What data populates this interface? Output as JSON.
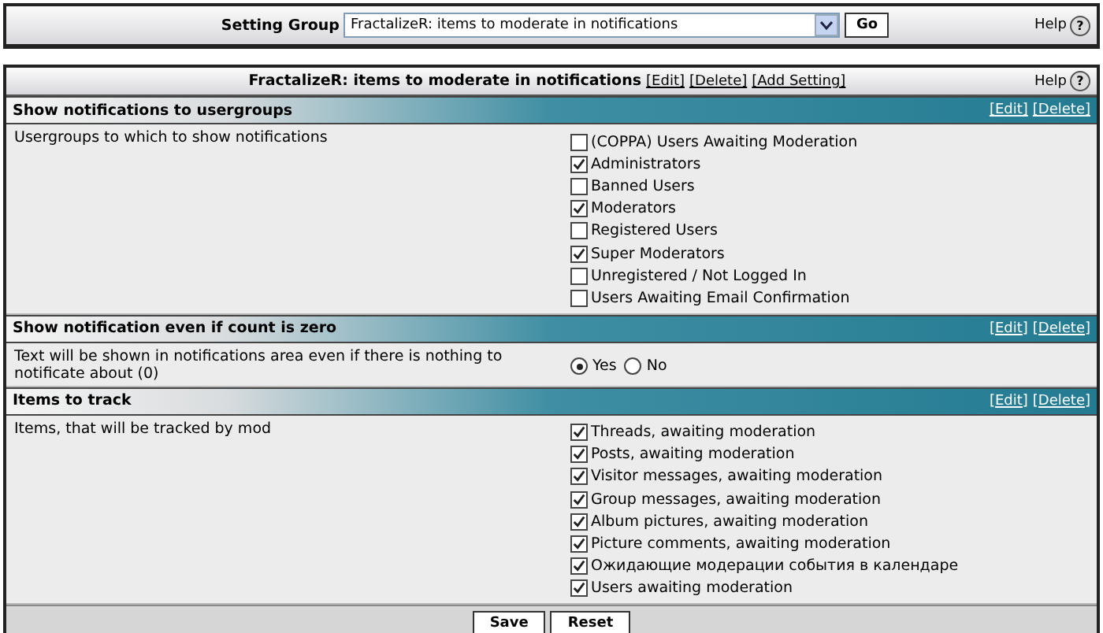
{
  "top_bar": {
    "label": "Setting Group",
    "select_value": "FractalizeR: items to moderate in notifications",
    "go_button": "Go",
    "help": "Help",
    "help_icon": "?"
  },
  "panel": {
    "title": "FractalizeR: items to moderate in notifications",
    "links": [
      "[Edit]",
      "[Delete]",
      "[Add Setting]"
    ],
    "help": "Help",
    "help_icon": "?",
    "sections": [
      {
        "title": "Show notifications to usergroups",
        "links": [
          "[Edit]",
          "[Delete]"
        ],
        "description": "Usergroups to which to show notifications",
        "kind": "checkboxes",
        "options": [
          {
            "label": "(COPPA) Users Awaiting Moderation",
            "checked": false
          },
          {
            "label": "Administrators",
            "checked": true
          },
          {
            "label": "Banned Users",
            "checked": false
          },
          {
            "label": "Moderators",
            "checked": true
          },
          {
            "label": "Registered Users",
            "checked": false
          },
          {
            "label": "Super Moderators",
            "checked": true
          },
          {
            "label": "Unregistered / Not Logged In",
            "checked": false
          },
          {
            "label": "Users Awaiting Email Confirmation",
            "checked": false
          }
        ]
      },
      {
        "title": "Show notification even if count is zero",
        "links": [
          "[Edit]",
          "[Delete]"
        ],
        "description": "Text will be shown in notifications area even if there is nothing to notificate about (0)",
        "kind": "radios",
        "options": [
          {
            "label": "Yes",
            "selected": true
          },
          {
            "label": "No",
            "selected": false
          }
        ]
      },
      {
        "title": "Items to track",
        "links": [
          "[Edit]",
          "[Delete]"
        ],
        "description": "Items, that will be tracked by mod",
        "kind": "checkboxes",
        "options": [
          {
            "label": "Threads, awaiting moderation",
            "checked": true
          },
          {
            "label": "Posts, awaiting moderation",
            "checked": true
          },
          {
            "label": "Visitor messages, awaiting moderation",
            "checked": true
          },
          {
            "label": "Group messages, awaiting moderation",
            "checked": true
          },
          {
            "label": "Album pictures, awaiting moderation",
            "checked": true
          },
          {
            "label": "Picture comments, awaiting moderation",
            "checked": true
          },
          {
            "label": "Ожидающие модерации события в календаре",
            "checked": true
          },
          {
            "label": "Users awaiting moderation",
            "checked": true
          }
        ]
      }
    ],
    "buttons": [
      "Save",
      "Reset"
    ]
  }
}
